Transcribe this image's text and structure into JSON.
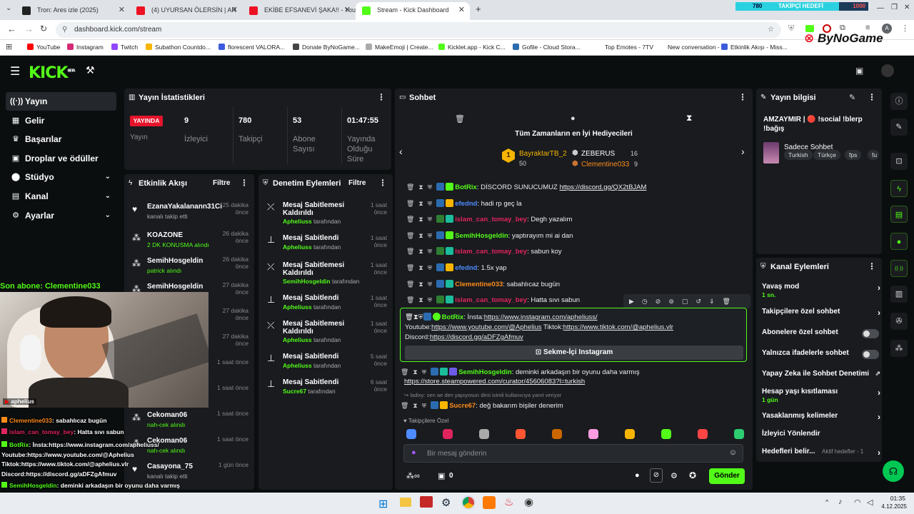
{
  "browser": {
    "tabs": [
      {
        "title": "Tron: Ares izle (2025)",
        "color": "#222"
      },
      {
        "title": "(4) UYURSAN ÖLERSİN | AR",
        "color": "#e12"
      },
      {
        "title": "EKİBE EFSANEVİ ŞAKA!! - YouTu",
        "color": "#e12"
      },
      {
        "title": "Stream - Kick Dashboard",
        "color": "#53fc18"
      }
    ],
    "url": "dashboard.kick.com/stream",
    "bookmarks": [
      {
        "label": "YouTube",
        "color": "#f00"
      },
      {
        "label": "Instagram",
        "color": "#d62976"
      },
      {
        "label": "Twitch",
        "color": "#9146ff"
      },
      {
        "label": "Subathon Countdo...",
        "color": "#f7b500"
      },
      {
        "label": "florescent VALORA...",
        "color": "#3b5bdb"
      },
      {
        "label": "Donate ByNoGame...",
        "color": "#444"
      },
      {
        "label": "MakeEmoji | Create...",
        "color": "#aaa"
      },
      {
        "label": "Kicklet.app - Kick C...",
        "color": "#53fc18"
      },
      {
        "label": "Gofile - Cloud Stora...",
        "color": "#2b6cb0"
      },
      {
        "label": "Top Emotes - 7TV",
        "color": "#fff"
      },
      {
        "label": "New conversation - ...",
        "color": "#fff"
      },
      {
        "label": "Etkinlik Akışı - Miss...",
        "color": "#3b5bdb"
      }
    ],
    "follower_goal": {
      "current": "780",
      "label": "TAKİPÇİ HEDEFİ",
      "target": "1000"
    },
    "brand": "ByNoGame"
  },
  "kick": {
    "logo": "KICK",
    "beta": "BETA"
  },
  "nav": [
    {
      "label": "Yayın",
      "icon": "((·))"
    },
    {
      "label": "Gelir",
      "icon": "▦"
    },
    {
      "label": "Başarılar",
      "icon": "♛"
    },
    {
      "label": "Droplar ve ödüller",
      "icon": "▣"
    },
    {
      "label": "Stüdyo",
      "icon": "⬤"
    },
    {
      "label": "Kanal",
      "icon": "▤"
    },
    {
      "label": "Ayarlar",
      "icon": "⚙"
    }
  ],
  "stats": {
    "title": "Yayın İstatistikleri",
    "live": "YAYINDA",
    "live_label": "Yayın",
    "items": [
      {
        "value": "9",
        "label": "İzleyici"
      },
      {
        "value": "780",
        "label": "Takipçi"
      },
      {
        "value": "53",
        "label": "Abone Sayısı"
      },
      {
        "value": "01:47:55",
        "label": "Yayında Olduğu Süre"
      }
    ]
  },
  "activity": {
    "title": "Etkinlik Akışı",
    "filter": "Filtre",
    "items": [
      {
        "name": "EzanaYakalanann31Ci",
        "sub": "kanalı takip etti",
        "time": "25 dakika önce"
      },
      {
        "name": "KOAZONE",
        "sub": "2 DK KONUSMA alındı",
        "time": "26 dakika önce"
      },
      {
        "name": "SemihHosgeldin",
        "sub": "patrick alındı",
        "time": "26 dakika önce"
      },
      {
        "name": "SemihHosgeldin",
        "sub": "",
        "time": "27 dakika önce"
      },
      {
        "name": "",
        "sub": "dı",
        "time": "27 dakika önce"
      },
      {
        "name": "",
        "sub": "dı",
        "time": "27 dakika önce"
      },
      {
        "name": "",
        "sub": "",
        "time": "1 saat önce"
      },
      {
        "name": "",
        "sub": "",
        "time": "1 saat önce"
      },
      {
        "name": "Cekoman06",
        "sub": "nah-cek alındı",
        "time": "1 saat önce"
      },
      {
        "name": "Cekoman06",
        "sub": "nah-cek alındı",
        "time": "1 saat önce"
      },
      {
        "name": "Casayona_75",
        "sub": "kanalı takip etti",
        "time": "1 gün önce"
      }
    ]
  },
  "moderation": {
    "title": "Denetim Eylemleri",
    "filter": "Filtre",
    "items": [
      {
        "action": "Mesaj Sabitlemesi Kaldırıldı",
        "by": "Apheliuss",
        "suffix": "tarafından",
        "time": "1 saat önce"
      },
      {
        "action": "Mesaj Sabitlendi",
        "by": "Apheliuss",
        "suffix": "tarafından",
        "time": "1 saat önce"
      },
      {
        "action": "Mesaj Sabitlemesi Kaldırıldı",
        "by": "SemihHosgeldin",
        "suffix": "tarafından",
        "time": "1 saat önce"
      },
      {
        "action": "Mesaj Sabitlendi",
        "by": "Apheliuss",
        "suffix": "tarafından",
        "time": "1 saat önce"
      },
      {
        "action": "Mesaj Sabitlemesi Kaldırıldı",
        "by": "Apheliuss",
        "suffix": "tarafından",
        "time": "1 saat önce"
      },
      {
        "action": "Mesaj Sabitlendi",
        "by": "Apheliuss",
        "suffix": "tarafından",
        "time": "5 saat önce"
      },
      {
        "action": "Mesaj Sabitlendi",
        "by": "Sucre67",
        "suffix": "tarafından",
        "time": "6 saat önce"
      }
    ]
  },
  "chat": {
    "title": "Sohbet",
    "gifters_title": "Tüm Zamanların en İyi Hediyecileri",
    "gifters": [
      {
        "name": "BayraktarTB_2",
        "count": "50"
      },
      {
        "name": "ZEBERUS",
        "count": "16"
      },
      {
        "name": "Clementine033",
        "count": "9"
      }
    ],
    "messages": [
      {
        "user": "BotRix",
        "color": "#53fc18",
        "text": "DİSCORD SUNUCUMUZ ",
        "link": "https://discord.gg/QX2tBJAM"
      },
      {
        "user": "efednd",
        "color": "#4e8cff",
        "text": "hadi rp geç la",
        "link": ""
      },
      {
        "user": "islam_can_tomay_bey",
        "color": "#e0245e",
        "text": "Degh yazalım",
        "link": ""
      },
      {
        "user": "SemihHosgeldin",
        "color": "#53fc18",
        "text": "yaptırayım mi ai dan",
        "link": ""
      },
      {
        "user": "islam_can_tomay_bey",
        "color": "#e0245e",
        "text": "sabun koy",
        "link": ""
      },
      {
        "user": "efednd",
        "color": "#4e8cff",
        "text": "1.5x yap",
        "link": ""
      },
      {
        "user": "Clementine033",
        "color": "#ff8c1a",
        "text": "sabahlıcaz bugün",
        "link": ""
      },
      {
        "user": "islam_can_tomay_bey",
        "color": "#e0245e",
        "text": "Hatta sıvı sabun",
        "link": ""
      }
    ],
    "pinned": {
      "user": "BotRix",
      "l1": "İnsta:",
      "l1link": "https://www.instagram.com/apheliuss/",
      "l2a": "Youtube:",
      "l2alink": "https://www.youtube.com/@Aphelius",
      "l2b": " Tiktok:",
      "l2blink": "https://www.tiktok.com/@aphelius.vlr",
      "l3": "Discord:",
      "l3link": "https://discord.gg/aDFZgAfmuv",
      "button": "Sekme-İçi Instagram"
    },
    "after": [
      {
        "user": "SemihHosgeldin",
        "color": "#53fc18",
        "text": "deminki arkadaşın bir oyunu daha varmış",
        "link": "https://store.steampowered.com/curator/45606083?l=turkish"
      }
    ],
    "reply_hint": "ladixy: sen ae den yapıyosun dimi isimli kullanıcıya yanıt veriyor",
    "last": {
      "user": "Sucre67",
      "color": "#ff8c1a",
      "text": "deǧ bakarım bişiler denerim"
    },
    "emote_label": "Takipçilere Özel",
    "placeholder": "Bir mesaj gönderin",
    "count": "0",
    "send": "Gönder"
  },
  "info": {
    "title": "Yayın bilgisi",
    "stream_title": "AMZAYMIR | 🔴 !social !blerp !bağış",
    "category": "Sadece Sohbet",
    "tags": [
      "Turkish",
      "Türkçe",
      "fps",
      "fu"
    ]
  },
  "channel": {
    "title": "Kanal Eylemleri",
    "items": [
      {
        "label": "Yavaş mod",
        "sub": "1 sn.",
        "type": "arrow"
      },
      {
        "label": "Takipçilere özel sohbet",
        "sub": "",
        "type": "arrow"
      },
      {
        "label": "Abonelere özel sohbet",
        "sub": "",
        "type": "toggle"
      },
      {
        "label": "Yalnızca ifadelerle sohbet",
        "sub": "",
        "type": "toggle"
      },
      {
        "label": "Yapay Zeka ile Sohbet Denetimi",
        "sub": "",
        "type": "ext"
      },
      {
        "label": "Hesap yaşı kısıtlaması",
        "sub": "1 gün",
        "type": "arrow"
      },
      {
        "label": "Yasaklanmış kelimeler",
        "sub": "",
        "type": "arrow"
      },
      {
        "label": "İzleyici Yönlendir",
        "sub": "",
        "type": "none"
      },
      {
        "label": "Hedefleri belir...",
        "sub": "",
        "type": "goal",
        "extra": "Aktif hedefler - 1"
      }
    ]
  },
  "overlay": {
    "sub_banner": "Son abone: Clementine033",
    "cam_name": "aphelius",
    "lines": [
      {
        "user": "Clementine033",
        "color": "#ff8c1a",
        "text": ": sabahlıcaz bugün"
      },
      {
        "user": "islam_can_tomay_bey",
        "color": "#e0245e",
        "text": ": Hatta sıvı sabun"
      },
      {
        "user": "BotRix",
        "color": "#53fc18",
        "text": ": İnsta:https://www.instagram.com/apheliuss/"
      },
      {
        "user": "",
        "color": "#fff",
        "text": "Youtube:https://www.youtube.com/@Aphelius"
      },
      {
        "user": "",
        "color": "#fff",
        "text": "Tiktok:https://www.tiktok.com/@aphelius.vlr"
      },
      {
        "user": "",
        "color": "#fff",
        "text": "Discord:https://discord.gg/aDFZgAfmuv"
      },
      {
        "user": "SemihHosgeldin",
        "color": "#53fc18",
        "text": ": deminki arkadaşın bir oyunu daha varmış"
      },
      {
        "user": "",
        "color": "#fff",
        "text": "https://store.steampowered.com/curator/45606083?l=turkish"
      },
      {
        "user": "Sucre67",
        "color": "#ff8c1a",
        "text": ": deǧ bakarım bişiler denerim"
      }
    ]
  },
  "taskbar": {
    "time": "01:35",
    "date": "4.12.2025"
  }
}
